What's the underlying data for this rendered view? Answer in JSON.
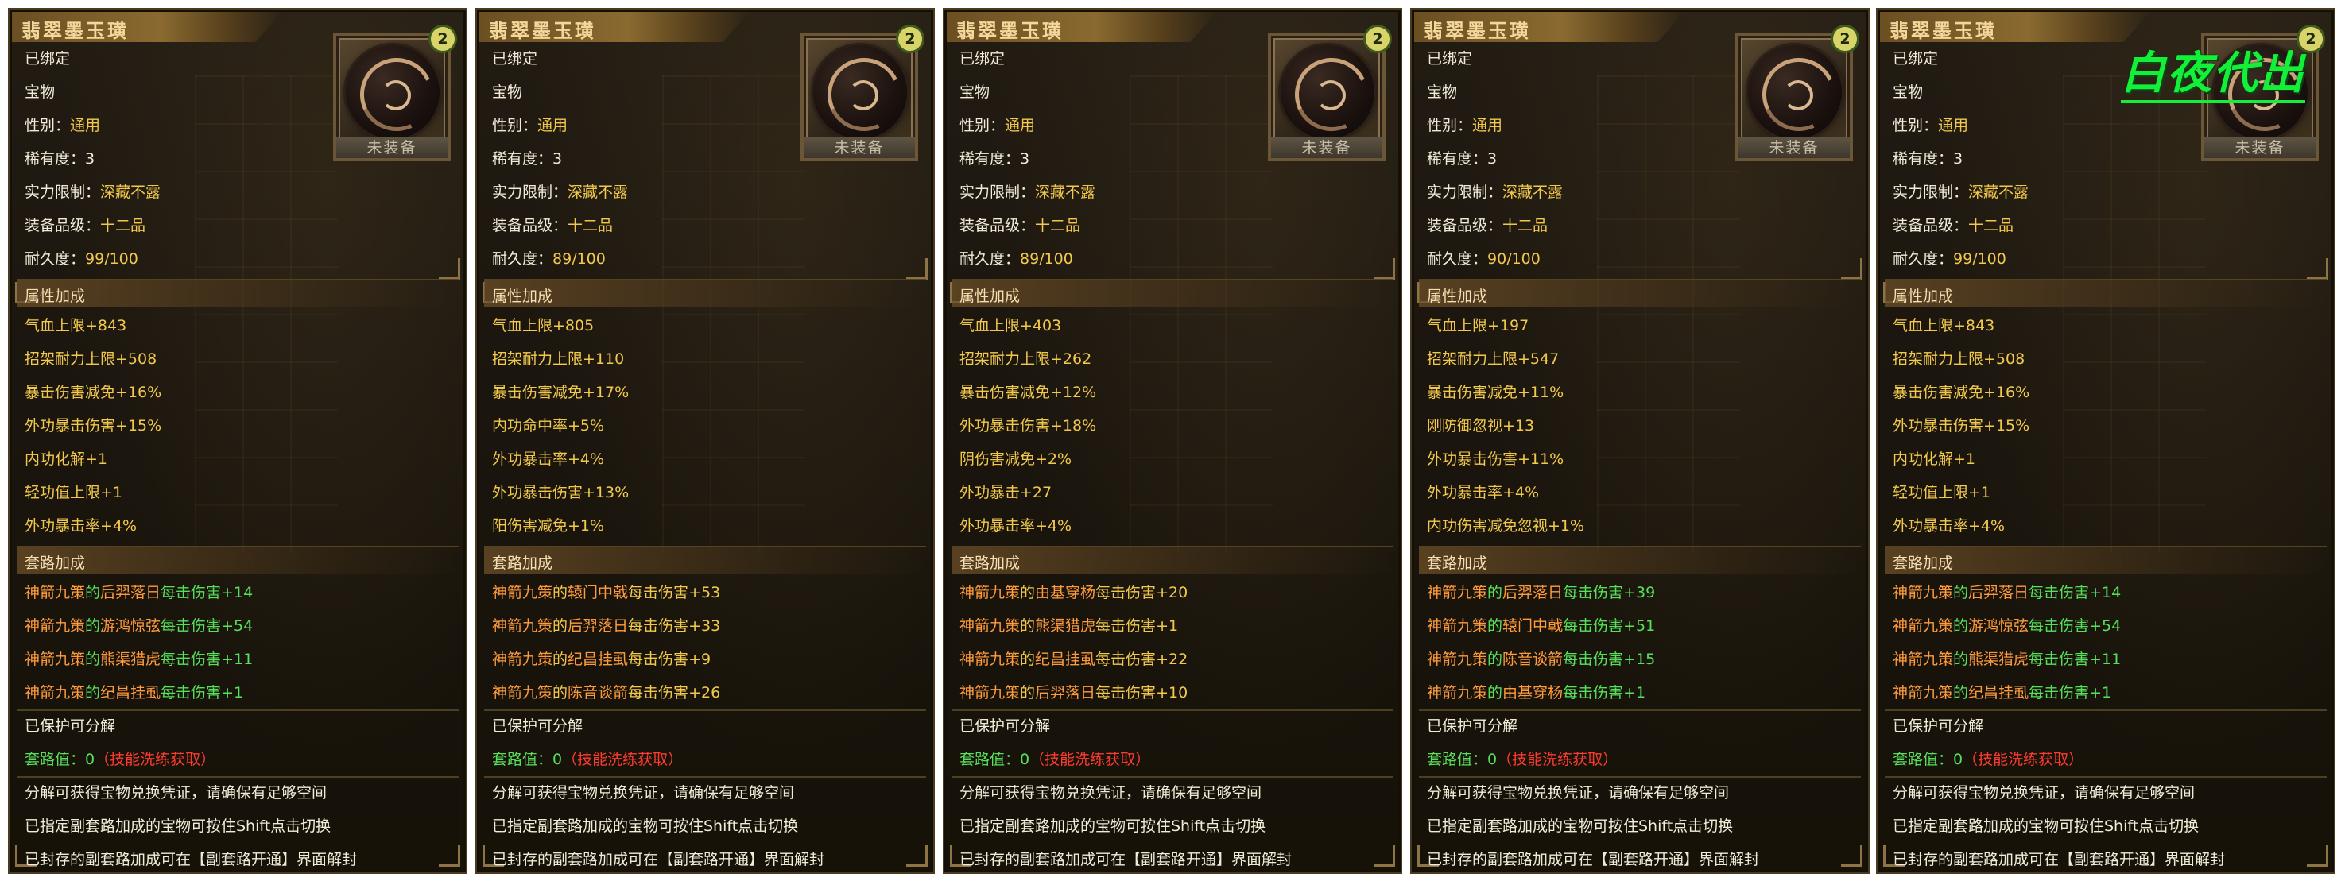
{
  "labels": {
    "title": "翡翠墨玉璜",
    "bound": "已绑定",
    "type": "宝物",
    "gender_key": "性别：",
    "gender_val": "通用",
    "rarity_key": "稀有度：",
    "rarity_val": "3",
    "power_key": "实力限制：",
    "power_val": "深藏不露",
    "grade_key": "装备品级：",
    "grade_val": "十二品",
    "dura_key": "耐久度：",
    "attr_header": "属性加成",
    "route_header": "套路加成",
    "of": "的",
    "per_hit": "每击伤害",
    "protected": "已保护可分解",
    "route_value_key": "套路值：",
    "route_value": "0",
    "route_value_note": "（技能洗练获取）",
    "note1": "分解可获得宝物兑换凭证，请确保有足够空间",
    "note2": "已指定副套路加成的宝物可按住Shift点击切换",
    "note3": "已封存的副套路加成可在【副套路开通】界面解封",
    "unequipped": "未装备",
    "tier_badge": "2"
  },
  "watermark": "白夜代出",
  "colors": {
    "title": "#f4d79a",
    "value_gold": "#f2c94c",
    "skill_orange": "#ff9b3d",
    "green": "#57e15b",
    "red": "#ff3b2f",
    "watermark": "#14f03a"
  },
  "panels": [
    {
      "durability": "99/100",
      "route_color": "green",
      "attributes": [
        "气血上限+843",
        "招架耐力上限+508",
        "暴击伤害减免+16%",
        "外功暴击伤害+15%",
        "内功化解+1",
        "轻功值上限+1",
        "外功暴击率+4%"
      ],
      "routes": [
        {
          "set": "神箭九策",
          "skill": "后羿落日",
          "value": "+14"
        },
        {
          "set": "神箭九策",
          "skill": "游鸿惊弦",
          "value": "+54"
        },
        {
          "set": "神箭九策",
          "skill": "熊渠猎虎",
          "value": "+11"
        },
        {
          "set": "神箭九策",
          "skill": "纪昌挂虱",
          "value": "+1"
        }
      ]
    },
    {
      "durability": "89/100",
      "route_color": "gold",
      "attributes": [
        "气血上限+805",
        "招架耐力上限+110",
        "暴击伤害减免+17%",
        "内功命中率+5%",
        "外功暴击率+4%",
        "外功暴击伤害+13%",
        "阳伤害减免+1%"
      ],
      "routes": [
        {
          "set": "神箭九策",
          "skill": "辕门中戟",
          "value": "+53"
        },
        {
          "set": "神箭九策",
          "skill": "后羿落日",
          "value": "+33"
        },
        {
          "set": "神箭九策",
          "skill": "纪昌挂虱",
          "value": "+9"
        },
        {
          "set": "神箭九策",
          "skill": "陈音谈箭",
          "value": "+26"
        }
      ]
    },
    {
      "durability": "89/100",
      "route_color": "gold",
      "attributes": [
        "气血上限+403",
        "招架耐力上限+262",
        "暴击伤害减免+12%",
        "外功暴击伤害+18%",
        "阴伤害减免+2%",
        "外功暴击+27",
        "外功暴击率+4%"
      ],
      "routes": [
        {
          "set": "神箭九策",
          "skill": "由基穿杨",
          "value": "+20"
        },
        {
          "set": "神箭九策",
          "skill": "熊渠猎虎",
          "value": "+1"
        },
        {
          "set": "神箭九策",
          "skill": "纪昌挂虱",
          "value": "+22"
        },
        {
          "set": "神箭九策",
          "skill": "后羿落日",
          "value": "+10"
        }
      ]
    },
    {
      "durability": "90/100",
      "route_color": "green",
      "attributes": [
        "气血上限+197",
        "招架耐力上限+547",
        "暴击伤害减免+11%",
        "刚防御忽视+13",
        "外功暴击伤害+11%",
        "外功暴击率+4%",
        "内功伤害减免忽视+1%"
      ],
      "routes": [
        {
          "set": "神箭九策",
          "skill": "后羿落日",
          "value": "+39"
        },
        {
          "set": "神箭九策",
          "skill": "辕门中戟",
          "value": "+51"
        },
        {
          "set": "神箭九策",
          "skill": "陈音谈箭",
          "value": "+15"
        },
        {
          "set": "神箭九策",
          "skill": "由基穿杨",
          "value": "+1"
        }
      ]
    },
    {
      "durability": "99/100",
      "route_color": "green",
      "attributes": [
        "气血上限+843",
        "招架耐力上限+508",
        "暴击伤害减免+16%",
        "外功暴击伤害+15%",
        "内功化解+1",
        "轻功值上限+1",
        "外功暴击率+4%"
      ],
      "routes": [
        {
          "set": "神箭九策",
          "skill": "后羿落日",
          "value": "+14"
        },
        {
          "set": "神箭九策",
          "skill": "游鸿惊弦",
          "value": "+54"
        },
        {
          "set": "神箭九策",
          "skill": "熊渠猎虎",
          "value": "+11"
        },
        {
          "set": "神箭九策",
          "skill": "纪昌挂虱",
          "value": "+1"
        }
      ]
    }
  ]
}
